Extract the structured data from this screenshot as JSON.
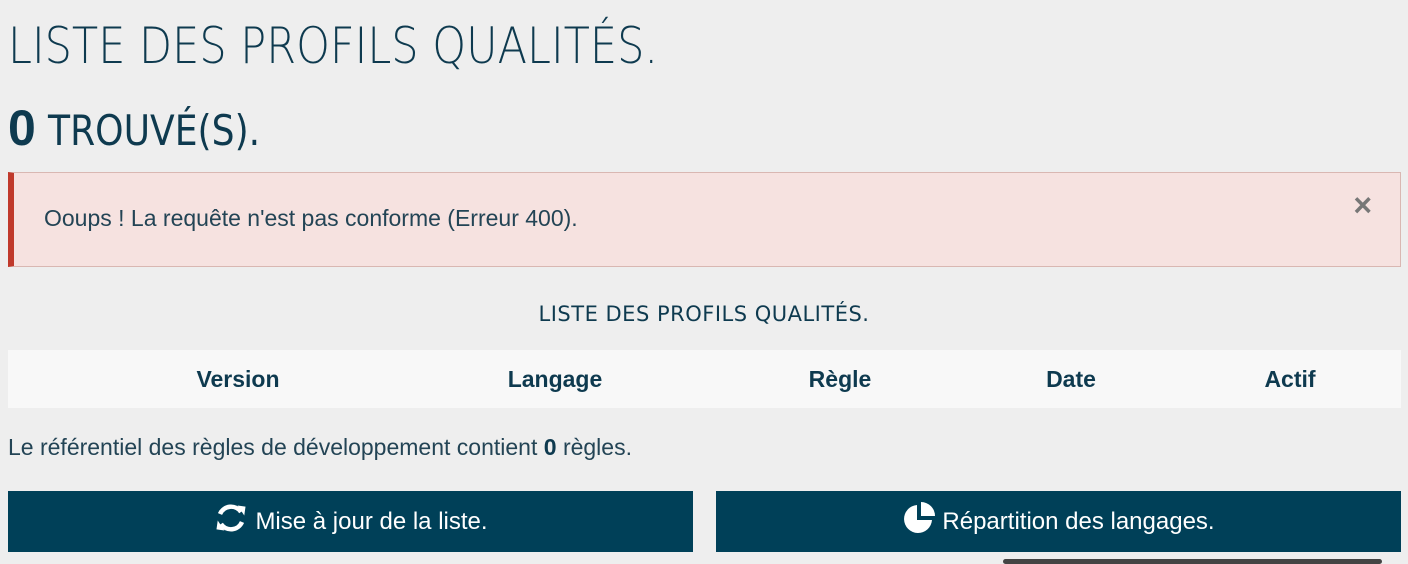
{
  "page": {
    "title": "LISTE DES PROFILS QUALITÉS.",
    "found_count": "0",
    "found_label": "TROUVÉ(S)."
  },
  "alert": {
    "message": "Ooups ! La requête n'est pas conforme (Erreur 400).",
    "close_symbol": "×"
  },
  "table": {
    "caption": "LISTE DES PROFILS QUALITÉS.",
    "headers": [
      "Version",
      "Langage",
      "Règle",
      "Date",
      "Actif"
    ]
  },
  "rules": {
    "prefix": "Le référentiel des règles de développement contient",
    "count": "0",
    "suffix": "règles."
  },
  "buttons": {
    "refresh_label": "Mise à jour de la liste.",
    "refresh_icon": "refresh-icon",
    "distribution_label": "Répartition des langages.",
    "distribution_icon": "pie-chart-icon"
  },
  "colors": {
    "primary": "#004058",
    "text": "#0e3a4f",
    "alert_bg": "#f6e2e0",
    "alert_border": "#c0392b",
    "background": "#eeeeee"
  }
}
